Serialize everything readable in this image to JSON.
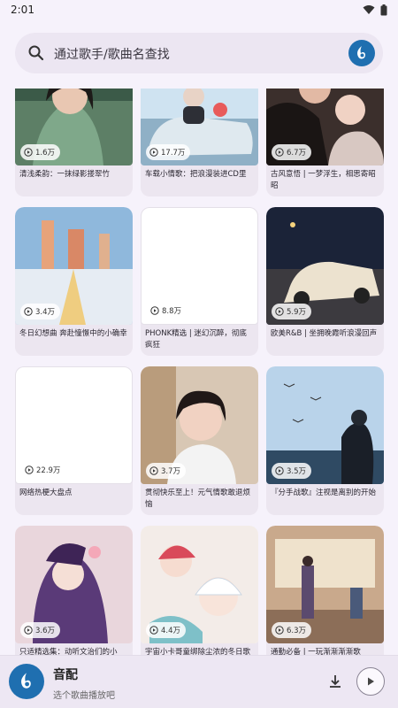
{
  "status_bar": {
    "time": "2:01"
  },
  "search": {
    "placeholder": "通过歌手/歌曲名查找"
  },
  "playlists": [
    {
      "plays": "1.6万",
      "title": "清浅柔韵：一抹绿影搂翠竹"
    },
    {
      "plays": "17.7万",
      "title": "车载小情歌：把浪漫装进CD里"
    },
    {
      "plays": "6.7万",
      "title": "古风意悟 | 一梦浮生，相思寄昭昭"
    },
    {
      "plays": "3.4万",
      "title": "冬日幻想曲 奔赴憧憬中的小确幸"
    },
    {
      "plays": "8.8万",
      "title": "PHONK精选 | 迷幻沉醉，彻底疯狂"
    },
    {
      "plays": "5.9万",
      "title": "欧美R&B | 坐拥晚霞听浪漫回声"
    },
    {
      "plays": "22.9万",
      "title": "网络热梗大盘点"
    },
    {
      "plays": "3.7万",
      "title": "贯彻快乐至上！元气情歌敢退烦恼"
    },
    {
      "plays": "3.5万",
      "title": "『分手战歌』注视是离别的开始"
    },
    {
      "plays": "3.6万",
      "title": "只适精选集：动听文治们的小众…"
    },
    {
      "plays": "4.4万",
      "title": "宇宙小卡哥童绑除尘浓的冬日歌"
    },
    {
      "plays": "6.3万",
      "title": "通勤必备 | 一玩渐渐渐渐歌"
    }
  ],
  "player": {
    "title": "音配",
    "subtitle": "选个歌曲播放吧"
  },
  "colors": {
    "accent": "#1f6fb0",
    "background": "#f6f2fb"
  }
}
